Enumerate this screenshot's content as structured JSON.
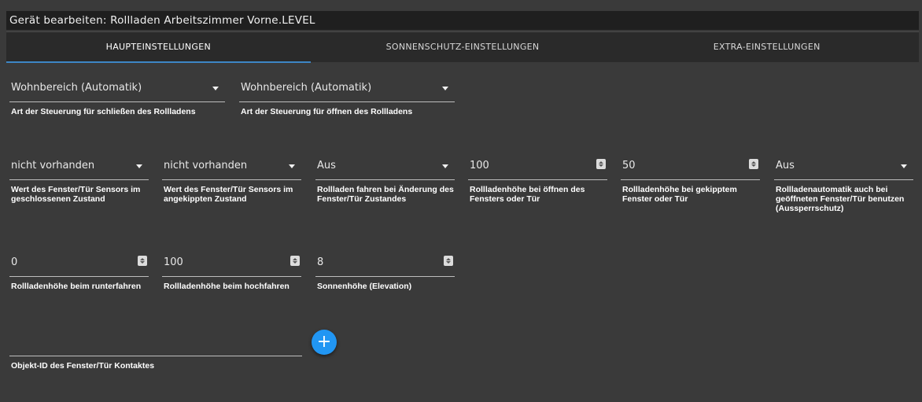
{
  "title": "Gerät bearbeiten: Rollladen Arbeitszimmer Vorne.LEVEL",
  "tabs": [
    {
      "label": "Haupteinstellungen"
    },
    {
      "label": "Sonnenschutz-Einstellungen"
    },
    {
      "label": "Extra-Einstellungen"
    }
  ],
  "row1": [
    {
      "value": "Wohnbereich (Automatik)",
      "label": "Art der Steuerung für schließen des Rollladens"
    },
    {
      "value": "Wohnbereich (Automatik)",
      "label": "Art der Steuerung für öffnen des Rollladens"
    }
  ],
  "row2": [
    {
      "value": "nicht vorhanden",
      "label": "Wert des Fenster/Tür Sensors im geschlossenen Zustand"
    },
    {
      "value": "nicht vorhanden",
      "label": "Wert des Fenster/Tür Sensors im angekippten Zustand"
    },
    {
      "value": "Aus",
      "label": "Rollladen fahren bei Änderung des Fenster/Tür Zustandes"
    },
    {
      "value": "100",
      "label": "Rollladenhöhe bei öffnen des Fensters oder Tür"
    },
    {
      "value": "50",
      "label": "Rollladenhöhe bei gekipptem Fenster oder Tür"
    },
    {
      "value": "Aus",
      "label": "Rollladenautomatik auch bei geöffneten Fenster/Tür benutzen (Aussperrschutz)"
    }
  ],
  "row3": [
    {
      "value": "0",
      "label": "Rollladenhöhe beim runterfahren"
    },
    {
      "value": "100",
      "label": "Rollladenhöhe beim hochfahren"
    },
    {
      "value": "8",
      "label": "Sonnenhöhe (Elevation)"
    }
  ],
  "contact": {
    "value": "",
    "label": "Objekt-ID des Fenster/Tür Kontaktes"
  },
  "add_button": {
    "symbol": "+"
  },
  "colors": {
    "accent": "#2196f3",
    "tab_indicator": "#3d86c6",
    "background": "#3a3a3a"
  }
}
